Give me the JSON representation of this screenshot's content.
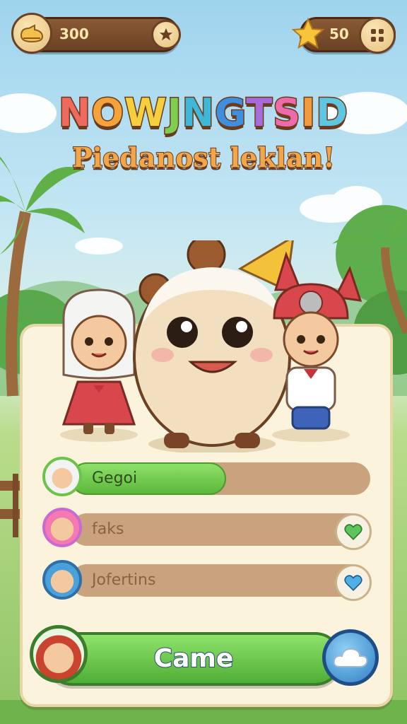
{
  "hud": {
    "coins": "300",
    "stars": "50"
  },
  "title": {
    "main": "NOWJNGTSID",
    "sub": "Piedanost leklan!"
  },
  "players": [
    {
      "name": "Gegoi",
      "progress": 0.52,
      "avatar": "girl-hijab-icon"
    },
    {
      "name": "faks",
      "progress": 0,
      "avatar": "girl-pigtails-icon",
      "heart": "green-heart-icon"
    },
    {
      "name": "Jofertins",
      "progress": 0,
      "avatar": "blue-hood-icon",
      "heart": "blue-heart-icon"
    }
  ],
  "play_button": {
    "label": "Came"
  },
  "colors": {
    "title_letters": [
      "#f0695f",
      "#f5a23a",
      "#f6cf3c",
      "#7fce4f",
      "#3db8d8",
      "#3f8fe0",
      "#a86ad8",
      "#ef6aa8",
      "#f59a3a",
      "#5ec6e0"
    ],
    "accent_green": "#5cb83a",
    "wood": "#6b4124"
  }
}
